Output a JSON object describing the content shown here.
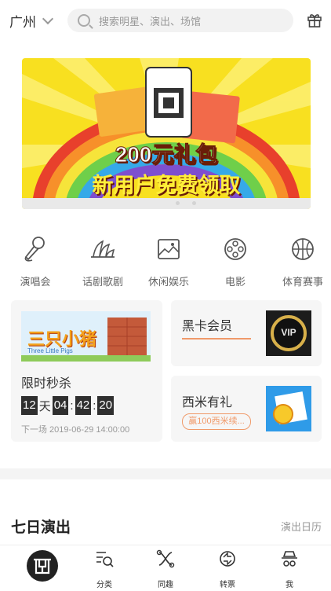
{
  "header": {
    "city": "广州",
    "search_placeholder": "搜索明星、演出、场馆"
  },
  "banner": {
    "line1": "200元礼包",
    "line2": "新用户免费领取"
  },
  "categories": [
    {
      "label": "演唱会",
      "icon": "microphone-icon"
    },
    {
      "label": "话剧歌剧",
      "icon": "opera-house-icon"
    },
    {
      "label": "休闲娱乐",
      "icon": "picture-icon"
    },
    {
      "label": "电影",
      "icon": "film-reel-icon"
    },
    {
      "label": "体育赛事",
      "icon": "basketball-icon"
    }
  ],
  "flash_sale": {
    "title": "限时秒杀",
    "image_title": "三只小猪",
    "image_subtitle": "Three Little Pigs",
    "timer": {
      "days": "12",
      "day_unit": "天",
      "hours": "04",
      "minutes": "42",
      "seconds": "20",
      "sep": ":"
    },
    "next": "下一场 2019-06-29 14:00:00"
  },
  "vip_card": {
    "label": "黑卡会员",
    "badge_text": "VIP"
  },
  "gift_card": {
    "label": "西米有礼",
    "badge": "赢100西米续..."
  },
  "section": {
    "title": "七日演出",
    "link": "演出日历"
  },
  "tabbar": [
    {
      "label": "",
      "icon": "home-logo-icon"
    },
    {
      "label": "分类",
      "icon": "category-search-icon"
    },
    {
      "label": "同趣",
      "icon": "interest-icon"
    },
    {
      "label": "转票",
      "icon": "transfer-ticket-icon"
    },
    {
      "label": "我",
      "icon": "profile-icon"
    }
  ],
  "colors": {
    "accent": "#f09a6a",
    "timer_bg": "#2f2f2f",
    "banner_yellow": "#f8e020"
  }
}
